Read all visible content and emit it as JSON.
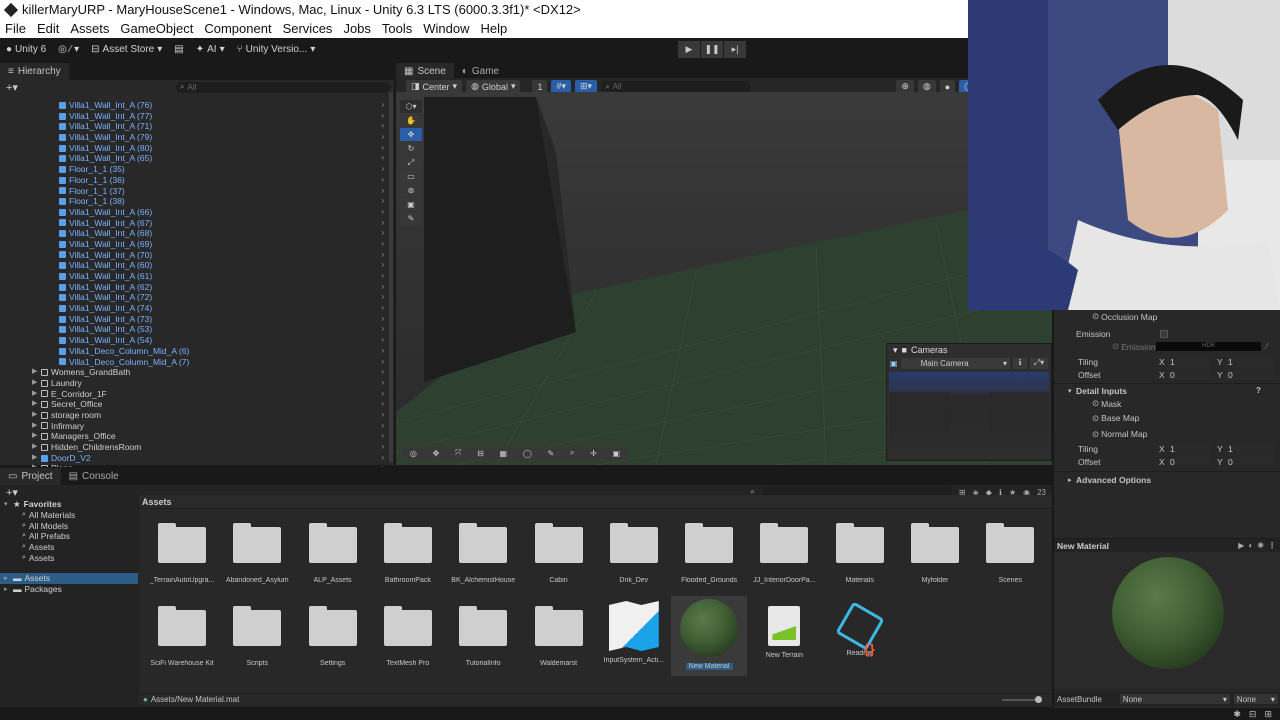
{
  "window": {
    "title": "killerMaryURP - MaryHouseScene1 - Windows, Mac, Linux - Unity 6.3 LTS (6000.3.3f1)* <DX12>"
  },
  "menu": [
    "File",
    "Edit",
    "Assets",
    "GameObject",
    "Component",
    "Services",
    "Jobs",
    "Tools",
    "Window",
    "Help"
  ],
  "toolbar": {
    "account": "Unity 6",
    "asset_store": "Asset Store",
    "ai": "AI",
    "version_control": "Unity Versio..."
  },
  "hierarchy": {
    "tab": "Hierarchy",
    "search_placeholder": "All",
    "items": [
      {
        "label": "Villa1_Wall_Int_A (76)",
        "kind": "blue",
        "indent": 1
      },
      {
        "label": "Villa1_Wall_Int_A (77)",
        "kind": "blue",
        "indent": 1
      },
      {
        "label": "Villa1_Wall_Int_A (71)",
        "kind": "blue",
        "indent": 1
      },
      {
        "label": "Villa1_Wall_Int_A (79)",
        "kind": "blue",
        "indent": 1
      },
      {
        "label": "Villa1_Wall_Int_A (80)",
        "kind": "blue",
        "indent": 1
      },
      {
        "label": "Villa1_Wall_Int_A (65)",
        "kind": "blue",
        "indent": 1
      },
      {
        "label": "Floor_1_1 (35)",
        "kind": "blue",
        "indent": 1
      },
      {
        "label": "Floor_1_1 (36)",
        "kind": "blue",
        "indent": 1
      },
      {
        "label": "Floor_1_1 (37)",
        "kind": "blue",
        "indent": 1
      },
      {
        "label": "Floor_1_1 (38)",
        "kind": "blue",
        "indent": 1
      },
      {
        "label": "Villa1_Wall_Int_A (66)",
        "kind": "blue",
        "indent": 1
      },
      {
        "label": "Villa1_Wall_Int_A (67)",
        "kind": "blue",
        "indent": 1
      },
      {
        "label": "Villa1_Wall_Int_A (68)",
        "kind": "blue",
        "indent": 1
      },
      {
        "label": "Villa1_Wall_Int_A (69)",
        "kind": "blue",
        "indent": 1
      },
      {
        "label": "Villa1_Wall_Int_A (70)",
        "kind": "blue",
        "indent": 1
      },
      {
        "label": "Villa1_Wall_Int_A (60)",
        "kind": "blue",
        "indent": 1
      },
      {
        "label": "Villa1_Wall_Int_A (61)",
        "kind": "blue",
        "indent": 1
      },
      {
        "label": "Villa1_Wall_Int_A (62)",
        "kind": "blue",
        "indent": 1
      },
      {
        "label": "Villa1_Wall_Int_A (72)",
        "kind": "blue",
        "indent": 1
      },
      {
        "label": "Villa1_Wall_Int_A (74)",
        "kind": "blue",
        "indent": 1
      },
      {
        "label": "Villa1_Wall_Int_A (73)",
        "kind": "blue",
        "indent": 1
      },
      {
        "label": "Villa1_Wall_Int_A (53)",
        "kind": "blue",
        "indent": 1
      },
      {
        "label": "Villa1_Wall_Int_A (54)",
        "kind": "blue",
        "indent": 1
      },
      {
        "label": "Villa1_Deco_Column_Mid_A (6)",
        "kind": "blue",
        "indent": 1
      },
      {
        "label": "Villa1_Deco_Column_Mid_A (7)",
        "kind": "blue",
        "indent": 1
      },
      {
        "label": "Womens_GrandBath",
        "kind": "white",
        "indent": 0
      },
      {
        "label": "Laundry",
        "kind": "white",
        "indent": 0
      },
      {
        "label": "E_Corridor_1F",
        "kind": "white",
        "indent": 0
      },
      {
        "label": "Secret_Office",
        "kind": "white",
        "indent": 0
      },
      {
        "label": "storage room",
        "kind": "white",
        "indent": 0
      },
      {
        "label": "Infirmary",
        "kind": "white",
        "indent": 0
      },
      {
        "label": "Managers_Office",
        "kind": "white",
        "indent": 0
      },
      {
        "label": "Hidden_ChildrensRoom",
        "kind": "white",
        "indent": 0
      },
      {
        "label": "DoorD_V2",
        "kind": "blue",
        "indent": 0
      },
      {
        "label": "Plane",
        "kind": "white",
        "indent": 0
      }
    ]
  },
  "scene": {
    "tab_scene": "Scene",
    "tab_game": "Game",
    "pivot": "Center",
    "space": "Global",
    "grid_value": "1",
    "search_placeholder": "All"
  },
  "cameras": {
    "title": "Cameras",
    "selected": "Main Camera"
  },
  "project": {
    "tab_project": "Project",
    "tab_console": "Console",
    "favorites_label": "Favorites",
    "favorites": [
      "All Materials",
      "All Models",
      "All Prefabs",
      "Assets",
      "Assets"
    ],
    "roots": [
      "Assets",
      "Packages"
    ],
    "breadcrumb": "Assets",
    "item_count": "23",
    "assets": [
      {
        "label": "_TerrainAutoUpgra...",
        "type": "folder"
      },
      {
        "label": "Abandoned_Asylum",
        "type": "folder"
      },
      {
        "label": "ALP_Assets",
        "type": "folder"
      },
      {
        "label": "BathroomPack",
        "type": "folder"
      },
      {
        "label": "BK_AlchemistHouse",
        "type": "folder"
      },
      {
        "label": "Cabin",
        "type": "folder"
      },
      {
        "label": "Dnk_Dev",
        "type": "folder"
      },
      {
        "label": "Flooded_Grounds",
        "type": "folder"
      },
      {
        "label": "JJ_InteriorDoorPa...",
        "type": "folder"
      },
      {
        "label": "Materials",
        "type": "folder"
      },
      {
        "label": "Myfolder",
        "type": "folder"
      },
      {
        "label": "Scenes",
        "type": "folder"
      },
      {
        "label": "SciFi Warehouse Kit",
        "type": "folder"
      },
      {
        "label": "Scripts",
        "type": "folder"
      },
      {
        "label": "Settings",
        "type": "folder"
      },
      {
        "label": "TextMesh Pro",
        "type": "folder"
      },
      {
        "label": "TutorialInfo",
        "type": "folder"
      },
      {
        "label": "Waldemarst",
        "type": "folder"
      },
      {
        "label": "InputSystem_Acti...",
        "type": "input"
      },
      {
        "label": "New Material",
        "type": "material"
      },
      {
        "label": "New Terrain",
        "type": "terrain"
      },
      {
        "label": "Readme",
        "type": "readme"
      }
    ],
    "footer_path": "Assets/New Material.mat"
  },
  "inspector": {
    "occlusion_map": "Occlusion Map",
    "emission": "Emission",
    "emission_map": "Emission M",
    "hdr": "HDR",
    "tiling": "Tiling",
    "offset": "Offset",
    "x": "X",
    "y": "Y",
    "tiling_x": "1",
    "tiling_y": "1",
    "offset_x": "0",
    "offset_y": "0",
    "detail_inputs": "Detail Inputs",
    "mask": "Mask",
    "base_map": "Base Map",
    "normal_map": "Normal Map",
    "detail_tiling_x": "1",
    "detail_tiling_y": "1",
    "detail_offset_x": "0",
    "detail_offset_y": "0",
    "advanced_options": "Advanced Options",
    "preview_title": "New Material",
    "asset_bundle_label": "AssetBundle",
    "asset_bundle_value": "None",
    "asset_bundle_variant": "None"
  },
  "colors": {
    "selection": "#2c5d87",
    "prefab_blue": "#7cb2ff",
    "material_green": "#3f5e33"
  }
}
